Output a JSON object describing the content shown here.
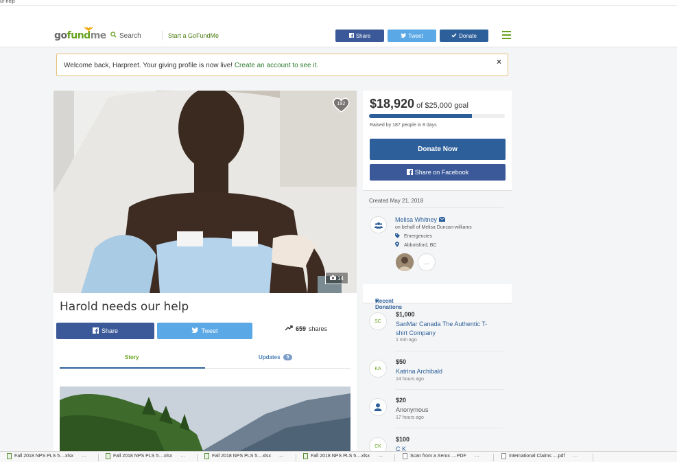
{
  "browser": {
    "tab_title": "ur-help"
  },
  "header": {
    "logo": {
      "go": "go",
      "fund": "fund",
      "me": "me"
    },
    "search_label": "Search",
    "start_label": "Start a GoFundMe",
    "share_label": "Share",
    "tweet_label": "Tweet",
    "donate_label": "Donate"
  },
  "welcome": {
    "message": "Welcome back, Harpreet. Your giving profile is now live!",
    "link": "Create an account to see it.",
    "close": "×"
  },
  "photo": {
    "hearts": "192",
    "photo_count": "14"
  },
  "campaign": {
    "title": "Harold needs our help",
    "share_label": "Share",
    "tweet_label": "Tweet",
    "shares_count": "659",
    "shares_label": "shares",
    "tabs": {
      "story": "Story",
      "updates": "Updates",
      "updates_badge": "5"
    }
  },
  "funding": {
    "raised": "$18,920",
    "of_goal": "of $25,000 goal",
    "progress_fraction": 0.757,
    "sub": "Raised by 187 people in 8 days",
    "donate_now": "Donate Now",
    "share_facebook": "Share on Facebook"
  },
  "organizer": {
    "created": "Created May 21, 2018",
    "name": "Melisa Whitney",
    "behalf": "on behalf of Melisa Duncan-williams",
    "category": "Emergencies",
    "location": "Abbotsford, BC",
    "more": "..."
  },
  "recent": {
    "label": "Recent Donations",
    "items": [
      {
        "initials": "SC",
        "amount": "$1,000",
        "name": "SanMar Canada The Authentic T-shirt Company",
        "time": "1 min ago"
      },
      {
        "initials": "KA",
        "amount": "$50",
        "name": "Katrina Archibald",
        "time": "14 hours ago"
      },
      {
        "initials": "",
        "amount": "$20",
        "name": "Anonymous",
        "time": "17 hours ago"
      },
      {
        "initials": "CK",
        "amount": "$100",
        "name": "C K",
        "time": ""
      }
    ]
  },
  "downloads": [
    {
      "name": "Fall 2018 NPS PLS 5....xlsx",
      "type": "xlsx"
    },
    {
      "name": "Fall 2018 NPS PLS 5....xlsx",
      "type": "xlsx"
    },
    {
      "name": "Fall 2018 NPS PLS 5....xlsx",
      "type": "xlsx"
    },
    {
      "name": "Fall 2018 NPS PLS 5....xlsx",
      "type": "xlsx"
    },
    {
      "name": "Scan from a Xerox ....PDF",
      "type": "pdf"
    },
    {
      "name": "International Claims ....pdf",
      "type": "pdf"
    }
  ],
  "colors": {
    "brand_green": "#66a21d",
    "brand_blue": "#2d5f9a",
    "facebook": "#3b5998",
    "twitter": "#5aa9e6"
  }
}
